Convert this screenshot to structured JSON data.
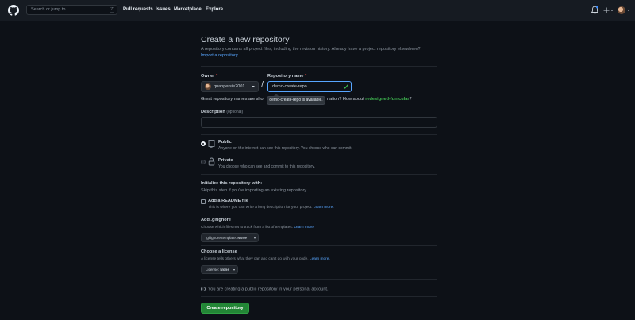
{
  "header": {
    "logo": "github-logo-icon",
    "search_placeholder": "Search or jump to...",
    "search_shortcut": "/",
    "nav": [
      "Pull requests",
      "Issues",
      "Marketplace",
      "Explore"
    ],
    "icons": [
      "bell-icon",
      "plus-icon",
      "avatar"
    ]
  },
  "page": {
    "title": "Create a new repository",
    "intro": "A repository contains all project files, including the revision history. Already have a project repository elsewhere?",
    "import_link": "Import a repository."
  },
  "form": {
    "owner_label": "Owner",
    "owner_value": "quanpersie2001",
    "required_mark": "*",
    "separator": "/",
    "repo_label": "Repository name",
    "repo_value": "demo-create-repo",
    "availability_tooltip": "demo-create-repo is available.",
    "hint_prefix": "Great repository names are shor",
    "hint_middle": "nation? How about",
    "hint_suggestion": "redesigned-funicular",
    "hint_suffix": "?",
    "description_label": "Description",
    "description_optional": "(optional)",
    "description_value": ""
  },
  "visibility": {
    "options": [
      {
        "label": "Public",
        "desc": "Anyone on the internet can see this repository. You choose who can commit.",
        "selected": true,
        "icon": "repo-icon"
      },
      {
        "label": "Private",
        "desc": "You choose who can see and commit to this repository.",
        "selected": false,
        "icon": "lock-icon"
      }
    ]
  },
  "init": {
    "title": "Initialize this repository with:",
    "desc": "Skip this step if you're importing an existing repository.",
    "readme_label": "Add a README file",
    "readme_desc": "This is where you can write a long description for your project.",
    "learn_more": "Learn more.",
    "gitignore_title": "Add .gitignore",
    "gitignore_desc": "Choose which files not to track from a list of templates.",
    "gitignore_select_prefix": ".gitignore template:",
    "gitignore_select_value": "None",
    "license_title": "Choose a license",
    "license_desc": "A license tells others what they can and can't do with your code.",
    "license_select_prefix": "License:",
    "license_select_value": "None"
  },
  "footer": {
    "info_text": "You are creating a public repository in your personal account.",
    "create_button": "Create repository"
  },
  "colors": {
    "background": "#0d1117",
    "header": "#161b22",
    "accent": "#58a6ff",
    "success": "#238636",
    "danger": "#f85149"
  }
}
